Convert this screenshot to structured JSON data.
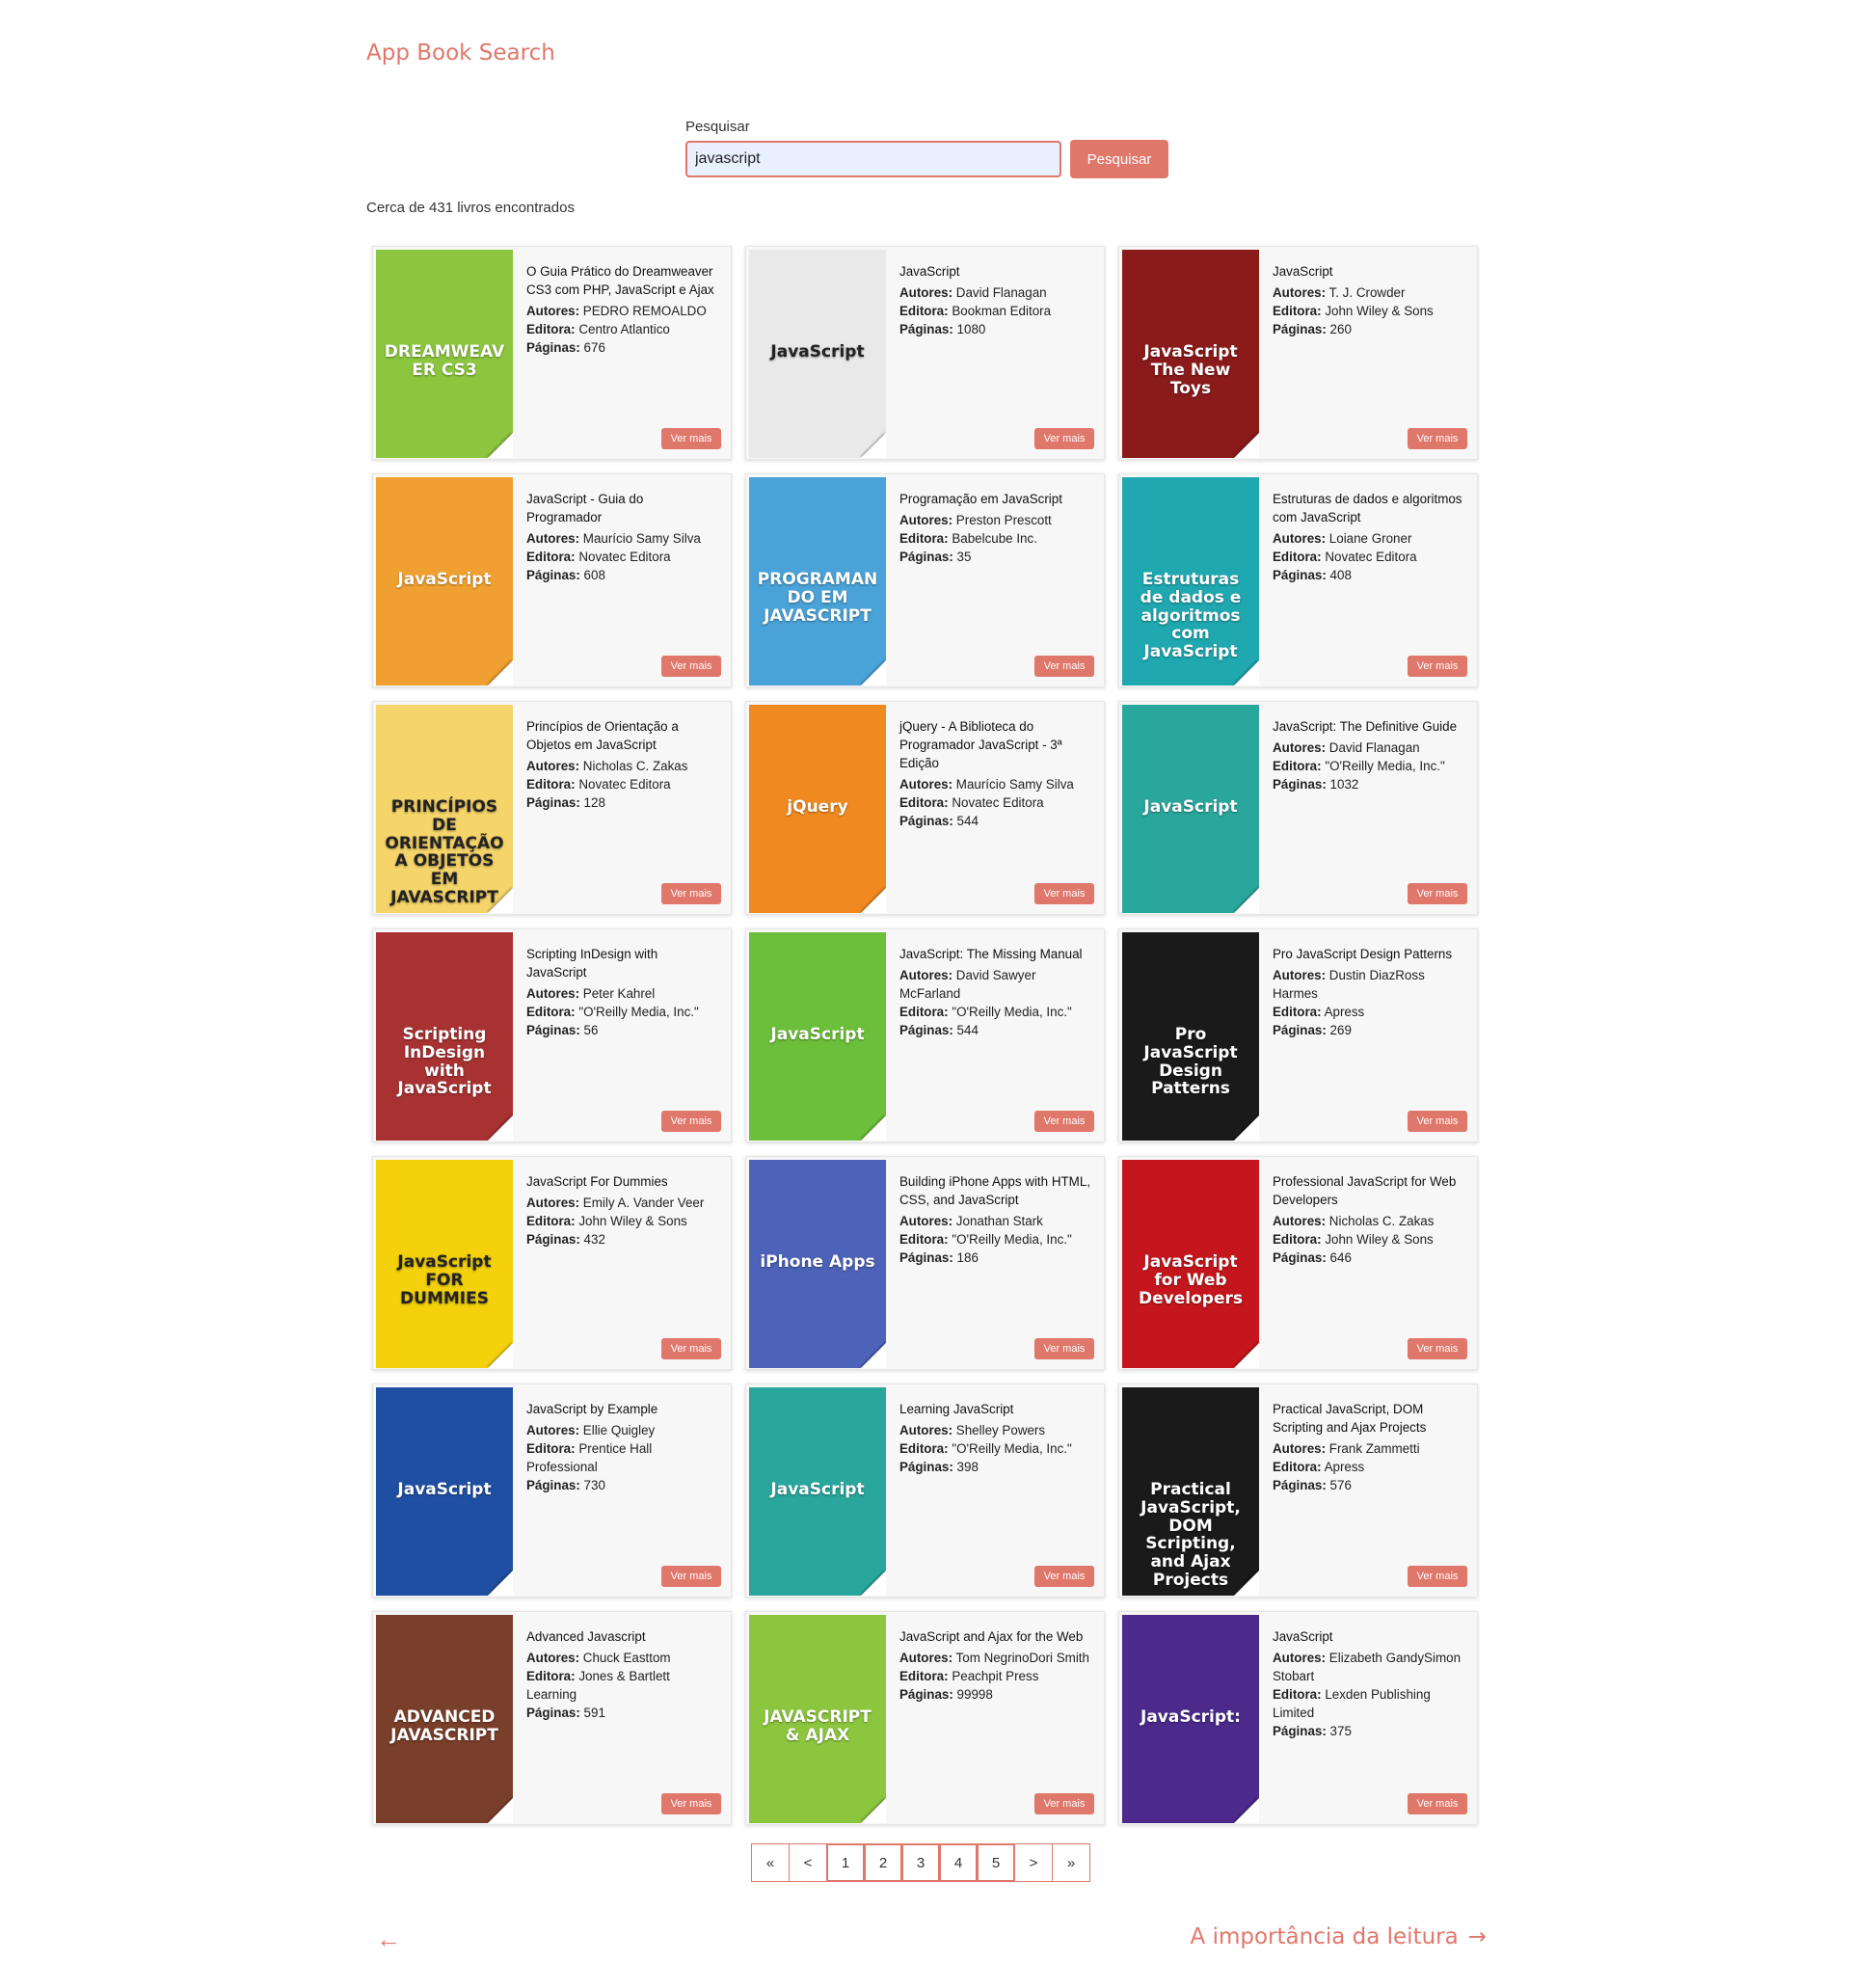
{
  "app": {
    "title": "App Book Search"
  },
  "search": {
    "label": "Pesquisar",
    "value": "javascript",
    "button_label": "Pesquisar"
  },
  "results": {
    "count_text": "Cerca de 431 livros encontrados"
  },
  "labels": {
    "authors": "Autores:",
    "publisher": "Editora:",
    "pages": "Páginas:",
    "more": "Ver mais"
  },
  "books": [
    {
      "title": "O Guia Prático do Dreamweaver CS3 com PHP, JavaScript e Ajax",
      "authors": "PEDRO REMOALDO",
      "publisher": "Centro Atlantico",
      "pages": "676",
      "cover_text": "DREAMWEAVER CS3",
      "cover_color": "#8cc63f"
    },
    {
      "title": "JavaScript",
      "authors": "David Flanagan",
      "publisher": "Bookman Editora",
      "pages": "1080",
      "cover_text": "JavaScript",
      "cover_color": "#e9e9e9"
    },
    {
      "title": "JavaScript",
      "authors": "T. J. Crowder",
      "publisher": "John Wiley & Sons",
      "pages": "260",
      "cover_text": "JavaScript The New Toys",
      "cover_color": "#8b1a1a"
    },
    {
      "title": "JavaScript - Guia do Programador",
      "authors": "Maurício Samy Silva",
      "publisher": "Novatec Editora",
      "pages": "608",
      "cover_text": "JavaScript",
      "cover_color": "#f0a030"
    },
    {
      "title": "Programação em JavaScript",
      "authors": "Preston Prescott",
      "publisher": "Babelcube Inc.",
      "pages": "35",
      "cover_text": "PROGRAMANDO EM JAVASCRIPT",
      "cover_color": "#4aa3d8"
    },
    {
      "title": "Estruturas de dados e algoritmos com JavaScript",
      "authors": "Loiane Groner",
      "publisher": "Novatec Editora",
      "pages": "408",
      "cover_text": "Estruturas de dados e algoritmos com JavaScript",
      "cover_color": "#1fa8b0"
    },
    {
      "title": "Princípios de Orientação a Objetos em JavaScript",
      "authors": "Nicholas C. Zakas",
      "publisher": "Novatec Editora",
      "pages": "128",
      "cover_text": "PRINCÍPIOS DE ORIENTAÇÃO A OBJETOS EM JAVASCRIPT",
      "cover_color": "#f5d46a"
    },
    {
      "title": "jQuery - A Biblioteca do Programador JavaScript - 3ª Edição",
      "authors": "Maurício Samy Silva",
      "publisher": "Novatec Editora",
      "pages": "544",
      "cover_text": "jQuery",
      "cover_color": "#f08a20"
    },
    {
      "title": "JavaScript: The Definitive Guide",
      "authors": "David Flanagan",
      "publisher": "\"O'Reilly Media, Inc.\"",
      "pages": "1032",
      "cover_text": "JavaScript",
      "cover_color": "#2aa79c"
    },
    {
      "title": "Scripting InDesign with JavaScript",
      "authors": "Peter Kahrel",
      "publisher": "\"O'Reilly Media, Inc.\"",
      "pages": "56",
      "cover_text": "Scripting InDesign with JavaScript",
      "cover_color": "#a83232"
    },
    {
      "title": "JavaScript: The Missing Manual",
      "authors": "David Sawyer McFarland",
      "publisher": "\"O'Reilly Media, Inc.\"",
      "pages": "544",
      "cover_text": "JavaScript",
      "cover_color": "#6cbf3a"
    },
    {
      "title": "Pro JavaScript Design Patterns",
      "authors": "Dustin DiazRoss Harmes",
      "publisher": "Apress",
      "pages": "269",
      "cover_text": "Pro JavaScript Design Patterns",
      "cover_color": "#1a1a1a"
    },
    {
      "title": "JavaScript For Dummies",
      "authors": "Emily A. Vander Veer",
      "publisher": "John Wiley & Sons",
      "pages": "432",
      "cover_text": "JavaScript FOR DUMMIES",
      "cover_color": "#f4d10a"
    },
    {
      "title": "Building iPhone Apps with HTML, CSS, and JavaScript",
      "authors": "Jonathan Stark",
      "publisher": "\"O'Reilly Media, Inc.\"",
      "pages": "186",
      "cover_text": "iPhone Apps",
      "cover_color": "#4d62b8"
    },
    {
      "title": "Professional JavaScript for Web Developers",
      "authors": "Nicholas C. Zakas",
      "publisher": "John Wiley & Sons",
      "pages": "646",
      "cover_text": "JavaScript for Web Developers",
      "cover_color": "#c4161c"
    },
    {
      "title": "JavaScript by Example",
      "authors": "Ellie Quigley",
      "publisher": "Prentice Hall Professional",
      "pages": "730",
      "cover_text": "JavaScript",
      "cover_color": "#1f4fa3"
    },
    {
      "title": "Learning JavaScript",
      "authors": "Shelley Powers",
      "publisher": "\"O'Reilly Media, Inc.\"",
      "pages": "398",
      "cover_text": "JavaScript",
      "cover_color": "#2aa79c"
    },
    {
      "title": "Practical JavaScript, DOM Scripting and Ajax Projects",
      "authors": "Frank Zammetti",
      "publisher": "Apress",
      "pages": "576",
      "cover_text": "Practical JavaScript, DOM Scripting, and Ajax Projects",
      "cover_color": "#1a1a1a"
    },
    {
      "title": "Advanced Javascript",
      "authors": "Chuck Easttom",
      "publisher": "Jones & Bartlett Learning",
      "pages": "591",
      "cover_text": "ADVANCED JAVASCRIPT",
      "cover_color": "#7a3f2a"
    },
    {
      "title": "JavaScript and Ajax for the Web",
      "authors": "Tom NegrinoDori Smith",
      "publisher": "Peachpit Press",
      "pages": "99998",
      "cover_text": "JAVASCRIPT & AJAX",
      "cover_color": "#8cc63f"
    },
    {
      "title": "JavaScript",
      "authors": "Elizabeth GandySimon Stobart",
      "publisher": "Lexden Publishing Limited",
      "pages": "375",
      "cover_text": "JavaScript:",
      "cover_color": "#4b2a8c"
    }
  ],
  "pagination": {
    "first": "«",
    "prev": "<",
    "pages": [
      "1",
      "2",
      "3",
      "4",
      "5"
    ],
    "next": ">",
    "last": "»"
  },
  "footer": {
    "back_icon": "arrow-left-icon",
    "next_label": "A importância da leitura",
    "next_icon": "arrow-right-icon"
  },
  "colors": {
    "accent": "#e0776b",
    "input_bg": "#e8f0fe"
  }
}
